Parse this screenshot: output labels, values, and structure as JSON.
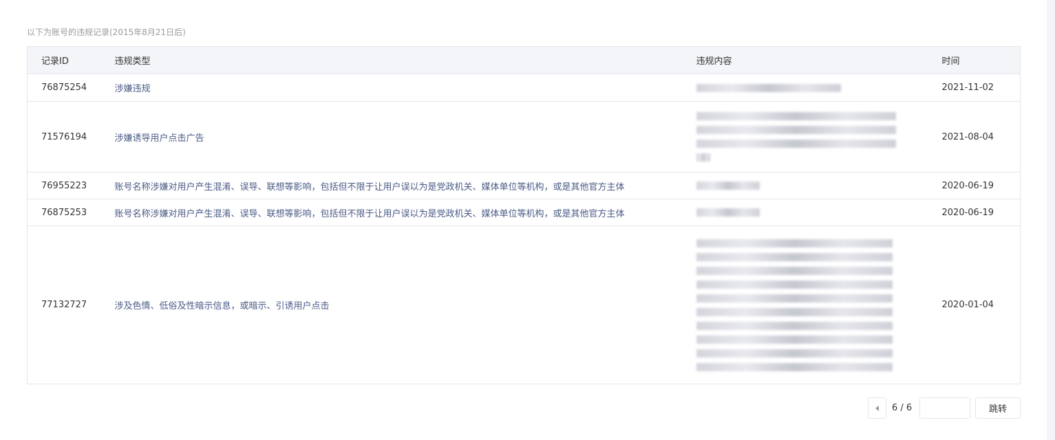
{
  "caption": "以下为账号的违规记录(2015年8月21日后)",
  "table": {
    "headers": [
      "记录ID",
      "违规类型",
      "违规内容",
      "时间"
    ],
    "rows": [
      {
        "id": "76875254",
        "type": "涉嫌违规",
        "date": "2021-11-02"
      },
      {
        "id": "71576194",
        "type": "涉嫌诱导用户点击广告",
        "date": "2021-08-04"
      },
      {
        "id": "76955223",
        "type": "账号名称涉嫌对用户产生混淆、误导、联想等影响，包括但不限于让用户误以为是党政机关、媒体单位等机构，或是其他官方主体",
        "date": "2020-06-19"
      },
      {
        "id": "76875253",
        "type": "账号名称涉嫌对用户产生混淆、误导、联想等影响，包括但不限于让用户误以为是党政机关、媒体单位等机构，或是其他官方主体",
        "date": "2020-06-19"
      },
      {
        "id": "77132727",
        "type": "涉及色情、低俗及性暗示信息，或暗示、引诱用户点击",
        "date": "2020-01-04"
      }
    ]
  },
  "pagination": {
    "current": "6 / 6",
    "jump_label": "跳转",
    "page_input_value": ""
  }
}
